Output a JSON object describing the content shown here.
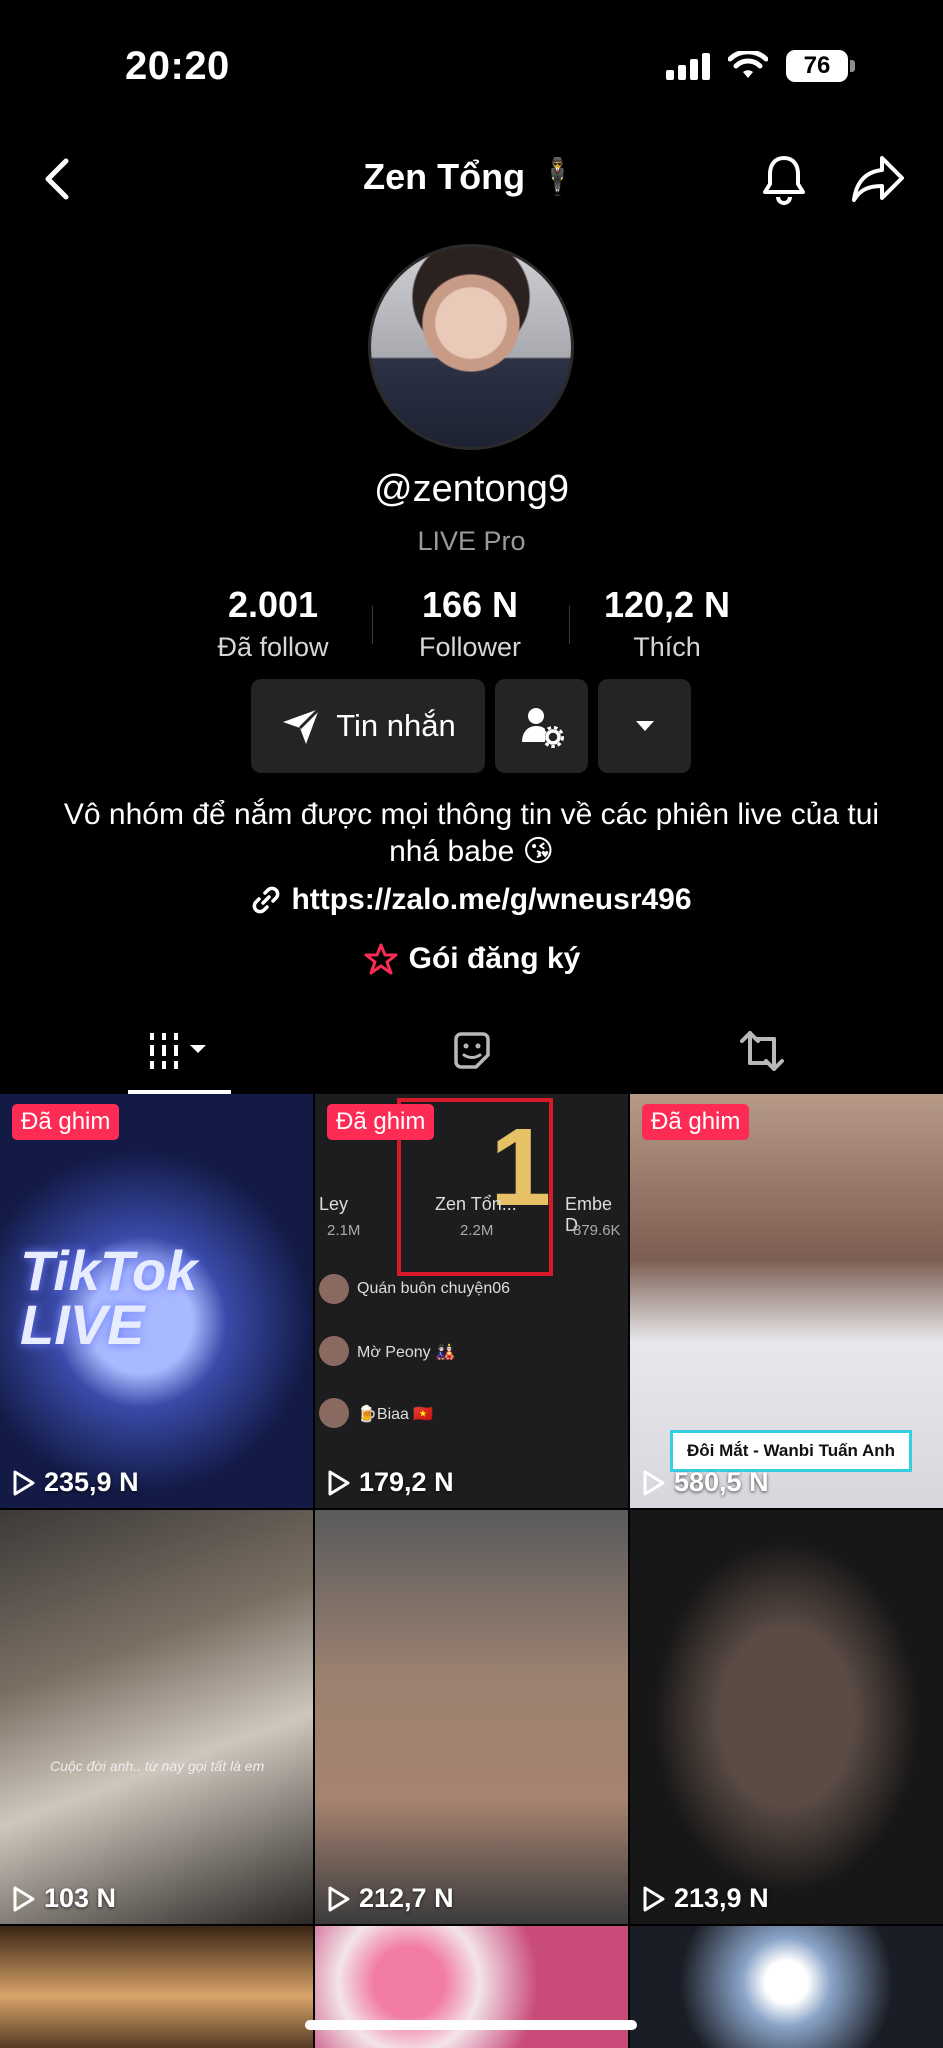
{
  "status_bar": {
    "time": "20:20",
    "battery": "76"
  },
  "header": {
    "title": "Zen Tổng 🕴️"
  },
  "profile": {
    "username": "@zentong9",
    "badge": "LIVE Pro",
    "bio": "Vô nhóm để nắm được mọi thông tin về các phiên live của tui nhá babe 😘",
    "link": "https://zalo.me/g/wneusr496",
    "subscription": "Gói đăng ký"
  },
  "stats": [
    {
      "value": "2.001",
      "label": "Đã follow"
    },
    {
      "value": "166 N",
      "label": "Follower"
    },
    {
      "value": "120,2 N",
      "label": "Thích"
    }
  ],
  "actions": {
    "message_label": "Tin nhắn"
  },
  "tabs": [
    {
      "icon": "videos-grid-icon",
      "active": true
    },
    {
      "icon": "sticker-icon",
      "active": false
    },
    {
      "icon": "repost-icon",
      "active": false
    }
  ],
  "videos": [
    {
      "pinned": "Đã ghim",
      "views": "235,9 N",
      "overlay": "TikTok LIVE"
    },
    {
      "pinned": "Đã ghim",
      "views": "179,2 N",
      "rank": {
        "place": "1",
        "center_name": "Zen Tổn...",
        "center_score": "2.2M",
        "left_name": "Ley",
        "left_score": "2.1M",
        "right_name": "Embe D",
        "right_score": "879.6K"
      },
      "chat": [
        "Quán buôn chuyện06",
        "Mờ Peony 🎎",
        "🍺Biaa 🇻🇳"
      ]
    },
    {
      "pinned": "Đã ghim",
      "views": "580,5 N",
      "tag": "Đôi Mắt - Wanbi Tuấn Anh"
    },
    {
      "pinned": "",
      "views": "103 N",
      "caption": "Cuộc đời anh.. từ nay gọi tất là em"
    },
    {
      "pinned": "",
      "views": "212,7 N"
    },
    {
      "pinned": "",
      "views": "213,9 N"
    },
    {
      "pinned": "",
      "views": ""
    },
    {
      "pinned": "",
      "views": ""
    },
    {
      "pinned": "",
      "views": ""
    }
  ],
  "colors": {
    "accent": "#fe2c55",
    "background": "#000000",
    "button": "#242424"
  }
}
